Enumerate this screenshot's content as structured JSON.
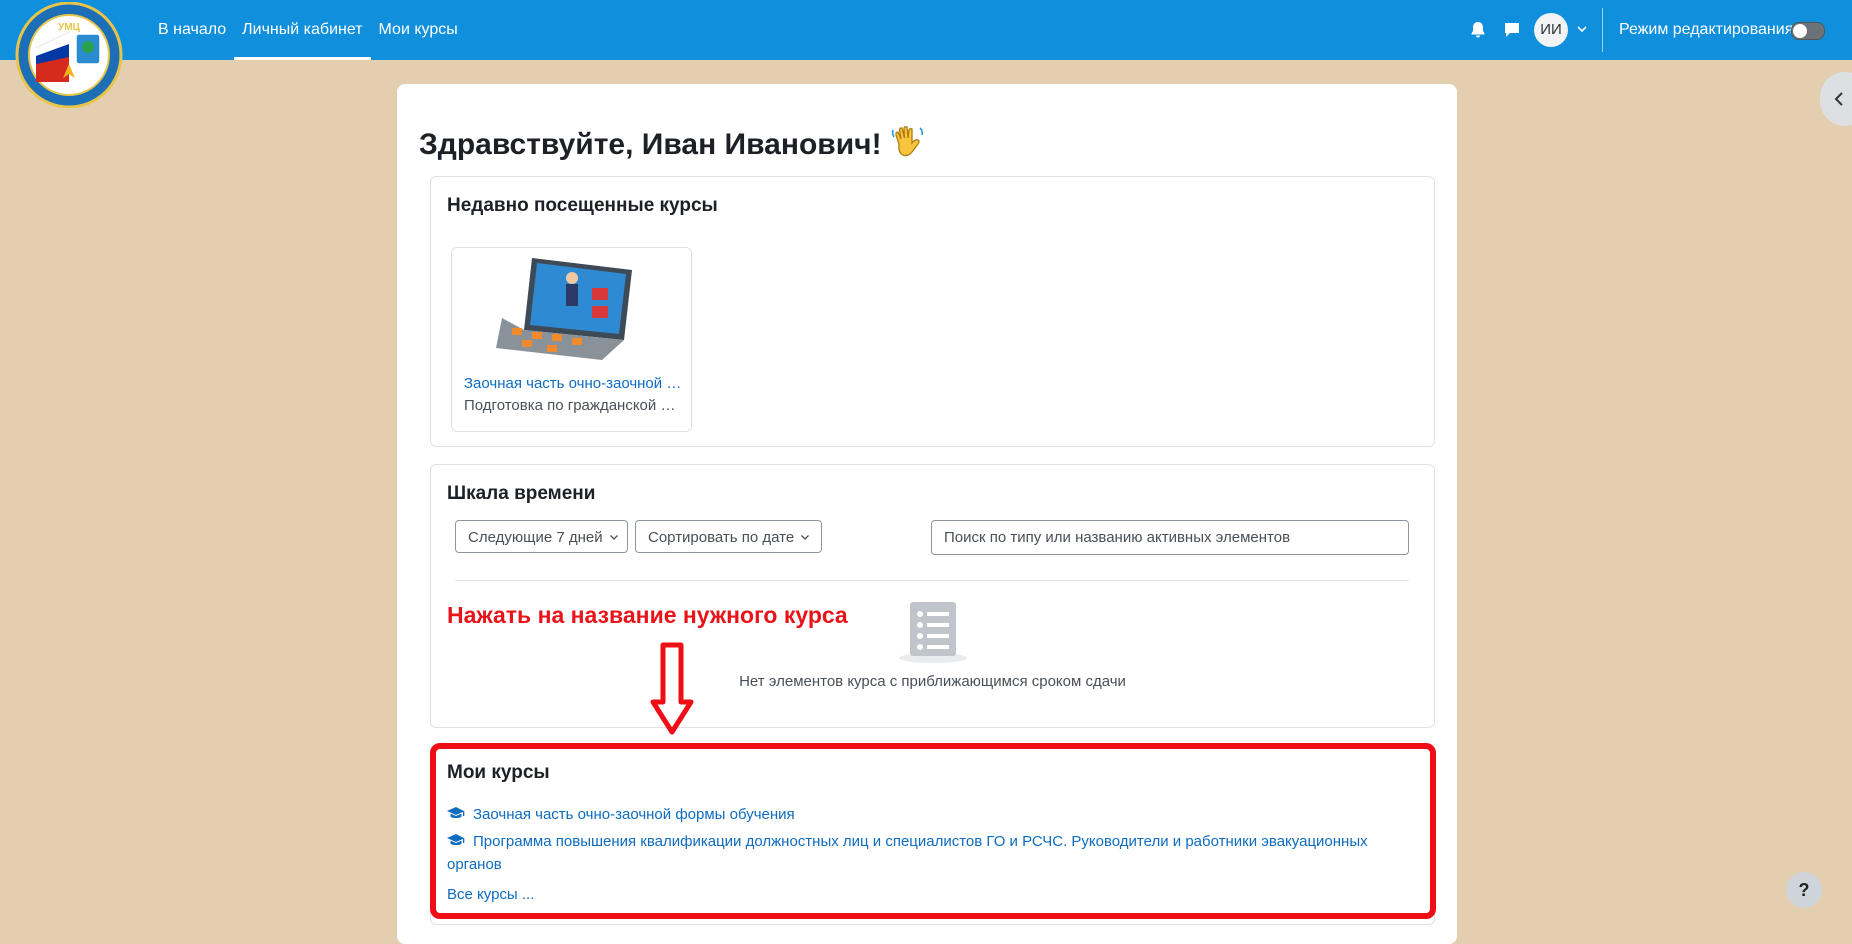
{
  "navbar": {
    "links": [
      {
        "label": "В начало"
      },
      {
        "label": "Личный кабинет",
        "active": true
      },
      {
        "label": "Мои курсы"
      }
    ],
    "avatar_initials": "ИИ",
    "edit_mode_label": "Режим редактирования",
    "edit_mode_on": false,
    "icons": [
      "bell-icon",
      "chat-icon",
      "chevron-down-icon"
    ],
    "accent_color": "#0f8fdc"
  },
  "greeting": "Здравствуйте, Иван Иванович!",
  "recent_courses": {
    "title": "Недавно посещенные курсы",
    "items": [
      {
        "name": "Заочная часть очно-заочной формы обучения",
        "category": "Подготовка по гражданской обороне"
      }
    ]
  },
  "timeline": {
    "title": "Шкала времени",
    "filter_days": "Следующие 7 дней",
    "sort": "Сортировать по дате",
    "search_placeholder": "Поиск по типу или названию активных элементов",
    "empty_text": "Нет элементов курса с приближающимся сроком сдачи"
  },
  "annotation": {
    "text": "Нажать на название нужного курса",
    "color": "#e8141a"
  },
  "my_courses": {
    "title": "Мои курсы",
    "items": [
      "Заочная часть очно-заочной формы обучения",
      "Программа повышения квалификации должностных лиц и специалистов ГО и РСЧС. Руководители и работники эвакуационных органов"
    ],
    "all_courses_link": "Все курсы ..."
  },
  "help_label": "?",
  "page_background": "#e4ceb0"
}
